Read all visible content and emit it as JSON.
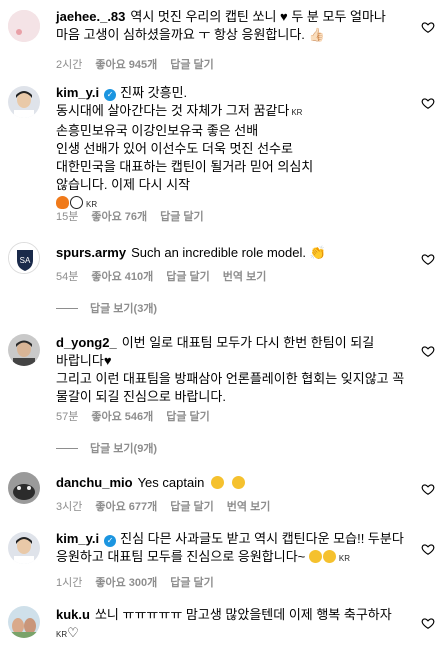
{
  "comments": [
    {
      "username": "jaehee._.83",
      "text": "역시 멋진 우리의 캡틴 쏘니 ♥ 두 분 모두 얼마나 마음 고생이 심하셨을까요 ㅜ 항상 응원합니다. 👍🏻",
      "time": "2시간",
      "likes": "좋아요 945개",
      "reply": "답글 달기"
    },
    {
      "username": "kim_y.i",
      "text": "진짜 갓흥민.",
      "line2": "동시대에 살아간다는 것 자체가 그저 꿈같다",
      "line3": "손흥민보유국 이강인보유국 좋은 선배",
      "line4": "인생 선배가 있어 이선수도 더욱 멋진 선수로",
      "line5": "대한민국을 대표하는 캡틴이 될거라 믿어 의심치",
      "line6": "않습니다. 이제 다시 시작",
      "kr": "KR",
      "time": "15분",
      "likes": "좋아요 76개",
      "reply": "답글 달기"
    },
    {
      "username": "spurs.army",
      "text": "Such an incredible role model. 👏",
      "time": "54분",
      "likes": "좋아요 410개",
      "reply": "답글 달기",
      "translate": "번역 보기",
      "view_replies": "답글 보기(3개)"
    },
    {
      "username": "d_yong2_",
      "text": "이번 일로 대표팀 모두가 다시 한번 한팀이 되길 바랍니다♥",
      "line2": "그리고 이런 대표팀을 방패삼아 언론플레이한 협회는 잊지않고 꼭 물갈이 되길 진심으로 바랍니다.",
      "time": "57분",
      "likes": "좋아요 546개",
      "reply": "답글 달기",
      "view_replies": "답글 보기(9개)"
    },
    {
      "username": "danchu_mio",
      "text": "Yes captain",
      "time": "3시간",
      "likes": "좋아요 677개",
      "reply": "답글 달기",
      "translate": "번역 보기"
    },
    {
      "username": "kim_y.i",
      "text": "진심 다믄 사과글도 받고 역시 캡틴다운 모습!! 두분다 응원하고 대표팀 모두를 진심으로 응원합니다~",
      "kr": "KR",
      "time": "1시간",
      "likes": "좋아요 300개",
      "reply": "답글 달기"
    },
    {
      "username": "kuk.u",
      "text": "쏘니 ㅠㅠㅠㅠㅠ 맘고생 많았을텐데 이제 행복 축구하자",
      "kr": "KR",
      "heart_glyph": "♡"
    }
  ],
  "icons": {
    "like": "heart-outline-icon",
    "verified": "verified-badge-icon"
  },
  "colors": {
    "meta": "#8e8e8e",
    "verified": "#1b95e0"
  }
}
